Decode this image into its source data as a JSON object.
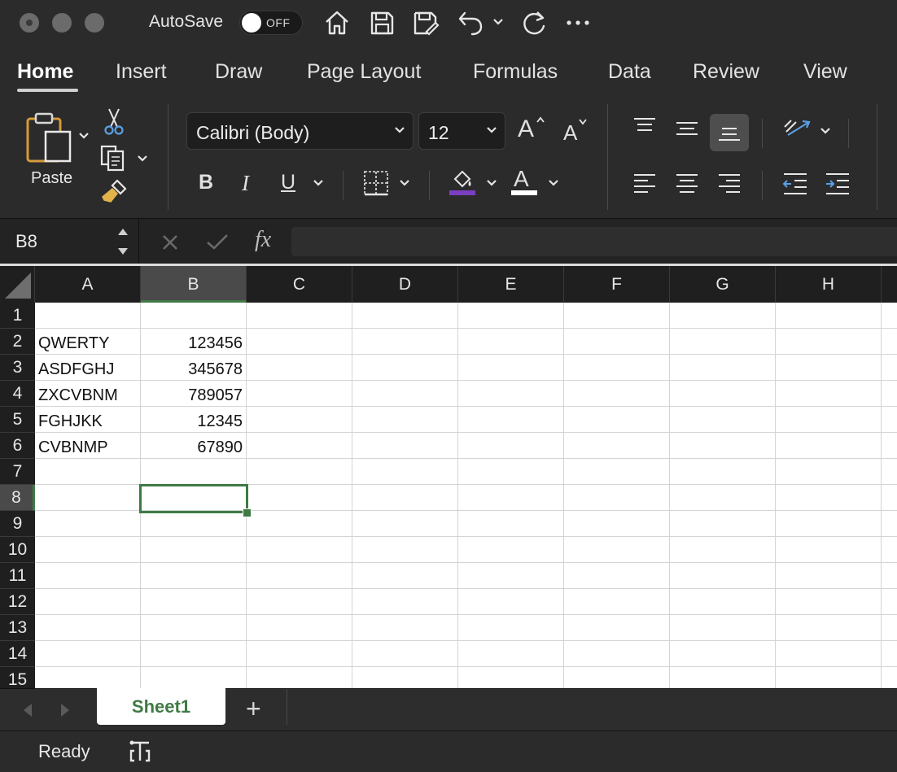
{
  "titlebar": {
    "autosave_label": "AutoSave",
    "autosave_state": "OFF"
  },
  "ribbon_tabs": [
    "Home",
    "Insert",
    "Draw",
    "Page Layout",
    "Formulas",
    "Data",
    "Review",
    "View"
  ],
  "active_tab": "Home",
  "ribbon": {
    "paste_label": "Paste",
    "font_name": "Calibri (Body)",
    "font_size": "12",
    "bold": "B",
    "italic": "I",
    "underline": "U",
    "grow_font": "A",
    "shrink_font": "A",
    "font_color_letter": "A",
    "fill_color": "#7a3fc0",
    "font_color": "#ffffff"
  },
  "formula_bar": {
    "name_box": "B8",
    "fx_label": "fx",
    "formula": ""
  },
  "grid": {
    "columns": [
      "A",
      "B",
      "C",
      "D",
      "E",
      "F",
      "G",
      "H"
    ],
    "rows": [
      "1",
      "2",
      "3",
      "4",
      "5",
      "6",
      "7",
      "8",
      "9",
      "10",
      "11",
      "12",
      "13",
      "14",
      "15"
    ],
    "selected_column": "B",
    "selected_row": "8",
    "cells": {
      "A2": "QWERTY",
      "B2": "123456",
      "A3": "ASDFGHJ",
      "B3": "345678",
      "A4": "ZXCVBNM",
      "B4": "789057",
      "A5": "FGHJKK",
      "B5": "12345",
      "A6": "CVBNMP",
      "B6": "67890"
    },
    "accent_color": "#3f7a45"
  },
  "sheets": {
    "tabs": [
      "Sheet1"
    ],
    "add_label": "+"
  },
  "status": {
    "text": "Ready"
  }
}
